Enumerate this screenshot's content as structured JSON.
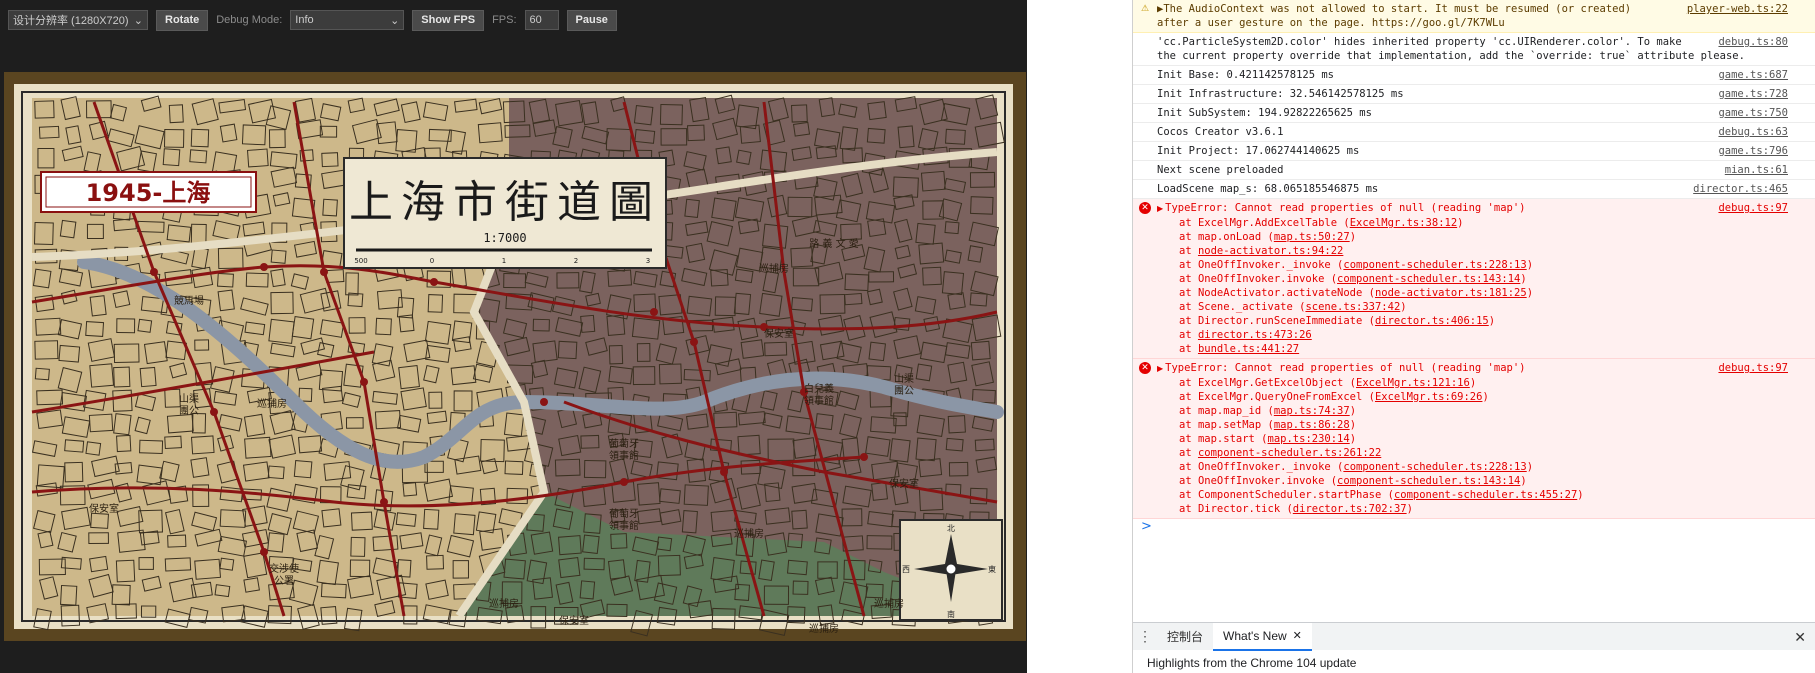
{
  "toolbar": {
    "resolution_select": "设计分辨率 (1280X720)",
    "rotate_label": "Rotate",
    "debug_mode_label": "Debug Mode:",
    "debug_mode_value": "Info",
    "show_fps_label": "Show FPS",
    "fps_label": "FPS:",
    "fps_value": "60",
    "pause_label": "Pause"
  },
  "game": {
    "year_badge": "1945-上海",
    "map_title": "上海市街道圖",
    "scale_text": "1:7000",
    "scale_ticks": [
      "500",
      "0",
      "1",
      "2",
      "3"
    ],
    "labels": [
      {
        "id": "jingmachang",
        "text": "競馬場"
      },
      {
        "id": "shanqu-left",
        "text": "山渠\n團公"
      },
      {
        "id": "buchufang-1",
        "text": "巡捕房"
      },
      {
        "id": "baoanshi-left",
        "text": "保安室"
      },
      {
        "id": "jiaoshe",
        "text": "交涉使\n公署"
      },
      {
        "id": "buchufang-2",
        "text": "巡捕房"
      },
      {
        "id": "baoanshi-bottom",
        "text": "保安室"
      },
      {
        "id": "wenyi-road",
        "text": "路 義 文 愛"
      },
      {
        "id": "buchufang-top",
        "text": "巡捕房"
      },
      {
        "id": "baoanshi-mid",
        "text": "保安室"
      },
      {
        "id": "ertong",
        "text": "白兒義\n領事館"
      },
      {
        "id": "shanqu-right",
        "text": "山渠\n團公"
      },
      {
        "id": "putao-1",
        "text": "葡萄牙\n領事館"
      },
      {
        "id": "putao-2",
        "text": "葡萄牙\n領事館"
      },
      {
        "id": "buchufang-mid",
        "text": "巡捕房"
      },
      {
        "id": "baoanshi-right",
        "text": "保安室"
      },
      {
        "id": "buchufang-br",
        "text": "巡捕房"
      },
      {
        "id": "buchufang-b2",
        "text": "巡捕房"
      }
    ],
    "compass_letters": [
      "北",
      "東",
      "南",
      "西"
    ]
  },
  "console": {
    "messages": [
      {
        "level": "warn",
        "text": "▶The AudioContext was not allowed to start. It must be resumed (or created)",
        "text2": "after a user gesture on the page. https://goo.gl/7K7WLu",
        "source": "player-web.ts:22"
      },
      {
        "level": "info",
        "text": "'cc.ParticleSystem2D.color' hides inherited property 'cc.UIRenderer.color'. To make",
        "text2": "the current property override that implementation, add the `override: true` attribute please.",
        "source": "debug.ts:80"
      },
      {
        "level": "info",
        "text": "Init Base: 0.421142578125 ms",
        "source": "game.ts:687"
      },
      {
        "level": "info",
        "text": "Init Infrastructure: 32.546142578125 ms",
        "source": "game.ts:728"
      },
      {
        "level": "info",
        "text": "Init SubSystem: 194.92822265625 ms",
        "source": "game.ts:750"
      },
      {
        "level": "info",
        "text": "Cocos Creator v3.6.1",
        "source": "debug.ts:63"
      },
      {
        "level": "info",
        "text": "Init Project: 17.062744140625 ms",
        "source": "game.ts:796"
      },
      {
        "level": "info",
        "text": "Next scene preloaded",
        "source": "mian.ts:61"
      },
      {
        "level": "info",
        "text": "LoadScene map_s: 68.065185546875 ms",
        "source": "director.ts:465"
      }
    ],
    "errors": [
      {
        "title": "TypeError: Cannot read properties of null (reading 'map')",
        "source": "debug.ts:97",
        "stack": [
          {
            "fn": "at ExcelMgr.AddExcelTable (",
            "loc": "ExcelMgr.ts:38:12",
            "end": ")"
          },
          {
            "fn": "at map.onLoad (",
            "loc": "map.ts:50:27",
            "end": ")"
          },
          {
            "fn": "at ",
            "loc": "node-activator.ts:94:22",
            "end": ""
          },
          {
            "fn": "at OneOffInvoker._invoke (",
            "loc": "component-scheduler.ts:228:13",
            "end": ")"
          },
          {
            "fn": "at OneOffInvoker.invoke (",
            "loc": "component-scheduler.ts:143:14",
            "end": ")"
          },
          {
            "fn": "at NodeActivator.activateNode (",
            "loc": "node-activator.ts:181:25",
            "end": ")"
          },
          {
            "fn": "at Scene._activate (",
            "loc": "scene.ts:337:42",
            "end": ")"
          },
          {
            "fn": "at Director.runSceneImmediate (",
            "loc": "director.ts:406:15",
            "end": ")"
          },
          {
            "fn": "at ",
            "loc": "director.ts:473:26",
            "end": ""
          },
          {
            "fn": "at ",
            "loc": "bundle.ts:441:27",
            "end": ""
          }
        ]
      },
      {
        "title": "TypeError: Cannot read properties of null (reading 'map')",
        "source": "debug.ts:97",
        "stack": [
          {
            "fn": "at ExcelMgr.GetExcelObject (",
            "loc": "ExcelMgr.ts:121:16",
            "end": ")"
          },
          {
            "fn": "at ExcelMgr.QueryOneFromExcel (",
            "loc": "ExcelMgr.ts:69:26",
            "end": ")"
          },
          {
            "fn": "at map.map_id (",
            "loc": "map.ts:74:37",
            "end": ")"
          },
          {
            "fn": "at map.setMap (",
            "loc": "map.ts:86:28",
            "end": ")"
          },
          {
            "fn": "at map.start (",
            "loc": "map.ts:230:14",
            "end": ")"
          },
          {
            "fn": "at ",
            "loc": "component-scheduler.ts:261:22",
            "end": ""
          },
          {
            "fn": "at OneOffInvoker._invoke (",
            "loc": "component-scheduler.ts:228:13",
            "end": ")"
          },
          {
            "fn": "at OneOffInvoker.invoke (",
            "loc": "component-scheduler.ts:143:14",
            "end": ")"
          },
          {
            "fn": "at ComponentScheduler.startPhase (",
            "loc": "component-scheduler.ts:455:27",
            "end": ")"
          },
          {
            "fn": "at Director.tick (",
            "loc": "director.ts:702:37",
            "end": ")"
          }
        ]
      }
    ],
    "prompt": ">"
  },
  "drawer": {
    "tab_console": "控制台",
    "tab_whats_new": "What's New",
    "close_tab": "✕",
    "close_drawer": "✕",
    "body_text": "Highlights from the Chrome 104 update"
  },
  "colors": {
    "map_tan": "#cdb88a",
    "map_brown": "#7b625e",
    "map_green": "#5f7a5a",
    "road_red": "#8a1414",
    "river": "#8b96a6",
    "badge_red": "#8a1010"
  }
}
